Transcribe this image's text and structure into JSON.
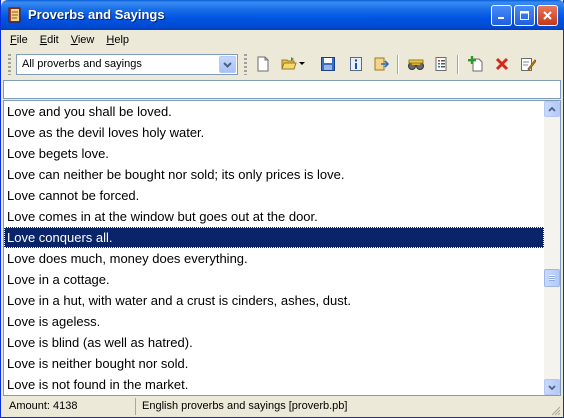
{
  "window": {
    "title": "Proverbs and Sayings",
    "icons": {
      "app": "book-icon",
      "minimize": "minimize-icon",
      "maximize": "maximize-icon",
      "close": "close-icon"
    }
  },
  "menu": [
    {
      "accel": "F",
      "rest": "ile"
    },
    {
      "accel": "E",
      "rest": "dit"
    },
    {
      "accel": "V",
      "rest": "iew"
    },
    {
      "accel": "H",
      "rest": "elp"
    }
  ],
  "toolbar": {
    "collection_select": "All proverbs and sayings",
    "tools": [
      "new-document-icon",
      "open-folder-icon",
      "save-icon",
      "info-icon",
      "export-icon",
      "find-icon",
      "list-icon",
      "add-icon",
      "delete-icon",
      "edit-icon"
    ]
  },
  "search": {
    "value": ""
  },
  "list": {
    "selected_index": 6,
    "items": [
      "Love and you shall be loved.",
      "Love as the devil loves holy water.",
      "Love begets love.",
      "Love can neither be bought nor sold; its only prices is love.",
      "Love cannot be forced.",
      "Love comes in at the window but goes out at the door.",
      "Love conquers all.",
      "Love does much, money does everything.",
      "Love in a cottage.",
      "Love in a hut, with water and a crust is cinders, ashes, dust.",
      "Love is ageless.",
      "Love is blind (as well as hatred).",
      "Love is neither bought nor sold.",
      "Love is not found in the market."
    ]
  },
  "status": {
    "amount": "Amount: 4138",
    "collection": "English proverbs and sayings [proverb.pb]"
  },
  "colors": {
    "selection": "#0a246a",
    "titlebar": "#0054e3",
    "frame": "#ece9d8"
  }
}
